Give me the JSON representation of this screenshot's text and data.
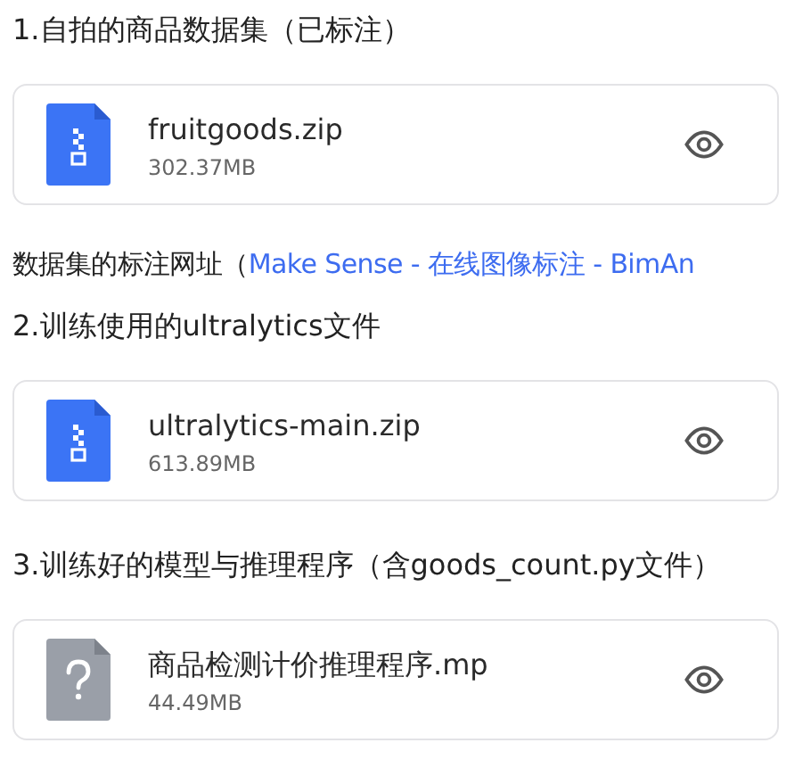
{
  "blocks": [
    {
      "kind": "heading",
      "text": "1.自拍的商品数据集（已标注）"
    },
    {
      "kind": "zip_file",
      "name": "fruitgoods.zip",
      "size": "302.37MB"
    },
    {
      "kind": "note",
      "text": "数据集的标注网址（",
      "link": "Make Sense - 在线图像标注 - BimAn"
    },
    {
      "kind": "heading",
      "text": "2.训练使用的ultralytics文件"
    },
    {
      "kind": "zip_file",
      "name": "ultralytics-main.zip",
      "size": "613.89MB"
    },
    {
      "kind": "heading",
      "text": "3.训练好的模型与推理程序（含goods_count.py文件）"
    },
    {
      "kind": "unknown_file",
      "name": "商品检测计价推理程序.mp",
      "size": "44.49MB"
    }
  ]
}
